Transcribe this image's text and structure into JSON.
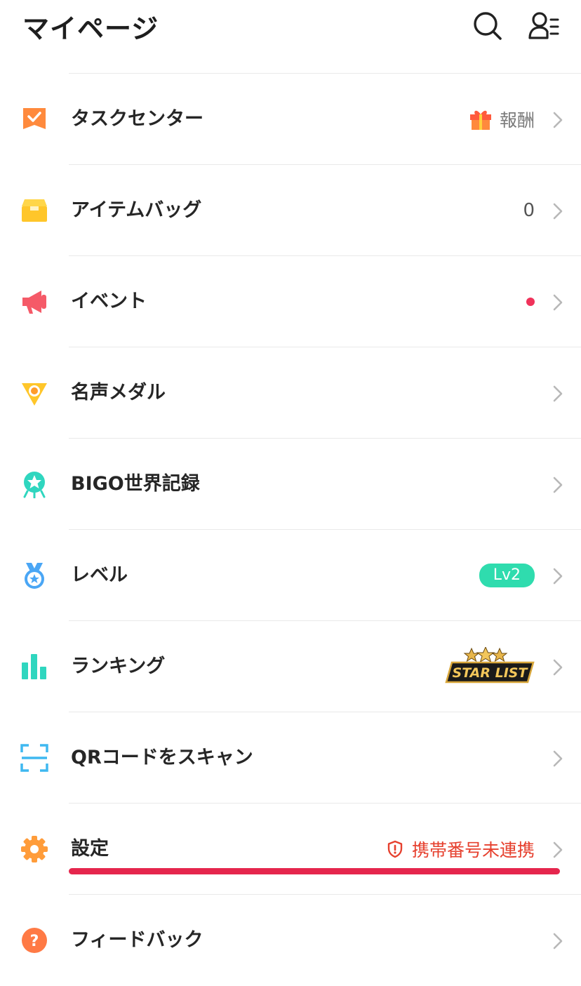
{
  "header": {
    "title": "マイページ",
    "search_icon": "search-icon",
    "profile_icon": "profile-list-icon"
  },
  "menu": [
    {
      "id": "task-center",
      "label": "タスクセンター",
      "icon": "task-check-icon",
      "icon_color": "#ff8a3d",
      "accessory": {
        "type": "gift",
        "text": "報酬"
      }
    },
    {
      "id": "item-bag",
      "label": "アイテムバッグ",
      "icon": "bag-icon",
      "icon_color": "#ffc62a",
      "accessory": {
        "type": "count",
        "text": "0"
      }
    },
    {
      "id": "event",
      "label": "イベント",
      "icon": "megaphone-icon",
      "icon_color": "#f55a68",
      "accessory": {
        "type": "dot"
      }
    },
    {
      "id": "fame-medal",
      "label": "名声メダル",
      "icon": "medal-pin-icon",
      "icon_color": "#ffc62a",
      "accessory": {
        "type": "none"
      }
    },
    {
      "id": "bigo-records",
      "label": "BIGO世界記録",
      "icon": "star-badge-icon",
      "icon_color": "#2fd6bf",
      "accessory": {
        "type": "none"
      }
    },
    {
      "id": "level",
      "label": "レベル",
      "icon": "level-medal-icon",
      "icon_color": "#4aa6f5",
      "accessory": {
        "type": "badge",
        "text": "Lv2"
      }
    },
    {
      "id": "ranking",
      "label": "ランキング",
      "icon": "bar-chart-icon",
      "icon_color": "#2fd6bf",
      "accessory": {
        "type": "starlist",
        "text": "STAR LIST"
      }
    },
    {
      "id": "qr-scan",
      "label": "QRコードをスキャン",
      "icon": "qr-scan-icon",
      "icon_color": "#3fb8f0",
      "accessory": {
        "type": "none"
      }
    },
    {
      "id": "settings",
      "label": "設定",
      "icon": "gear-icon",
      "icon_color": "#ff9c3a",
      "accessory": {
        "type": "warning",
        "text": "携帯番号未連携"
      }
    },
    {
      "id": "feedback",
      "label": "フィードバック",
      "icon": "help-icon",
      "icon_color": "#ff7a45",
      "accessory": {
        "type": "none"
      }
    }
  ],
  "colors": {
    "accent_red": "#e5264d",
    "warning": "#e6402e",
    "level_badge": "#2fdcae",
    "separator": "#e9e9e9"
  }
}
